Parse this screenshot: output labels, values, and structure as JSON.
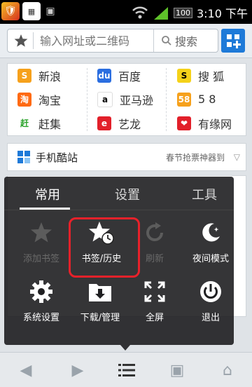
{
  "status_bar": {
    "time": "3:10 下午",
    "battery": "100"
  },
  "address_bar": {
    "url_placeholder": "输入网址或二维码",
    "search_label": "搜索"
  },
  "quick_links": [
    {
      "label": "新浪",
      "color": "#f6a11c",
      "glyph": "S"
    },
    {
      "label": "百度",
      "color": "#2b6ee0",
      "glyph": "du"
    },
    {
      "label": "搜 狐",
      "color": "#f5d21a",
      "glyph": "S"
    },
    {
      "label": "淘宝",
      "color": "#ff6a13",
      "glyph": "淘"
    },
    {
      "label": "亚马逊",
      "color": "#ffffff",
      "glyph": "a"
    },
    {
      "label": "5 8",
      "color": "#f6a11c",
      "glyph": "58"
    },
    {
      "label": "赶集",
      "color": "#ffffff",
      "glyph": "赶"
    },
    {
      "label": "艺龙",
      "color": "#e2202a",
      "glyph": "e"
    },
    {
      "label": "有缘网",
      "color": "#e2202a",
      "glyph": "❤"
    }
  ],
  "mobile_bar": {
    "title": "手机酷站",
    "promo": "春节抢票神器到"
  },
  "menu": {
    "tabs": [
      "常用",
      "设置",
      "工具"
    ],
    "items": [
      {
        "label": "添加书签",
        "icon": "add-bookmark-icon",
        "disabled": true
      },
      {
        "label": "书签/历史",
        "icon": "bookmark-history-icon",
        "disabled": false
      },
      {
        "label": "刷新",
        "icon": "refresh-icon",
        "disabled": true
      },
      {
        "label": "夜间模式",
        "icon": "night-mode-icon",
        "disabled": false
      },
      {
        "label": "系统设置",
        "icon": "settings-gear-icon",
        "disabled": false
      },
      {
        "label": "下载/管理",
        "icon": "download-icon",
        "disabled": false
      },
      {
        "label": "全屏",
        "icon": "fullscreen-icon",
        "disabled": false
      },
      {
        "label": "退出",
        "icon": "power-icon",
        "disabled": false
      }
    ]
  },
  "colors": {
    "accent": "#1e7ad8",
    "highlight": "#e8212a"
  }
}
